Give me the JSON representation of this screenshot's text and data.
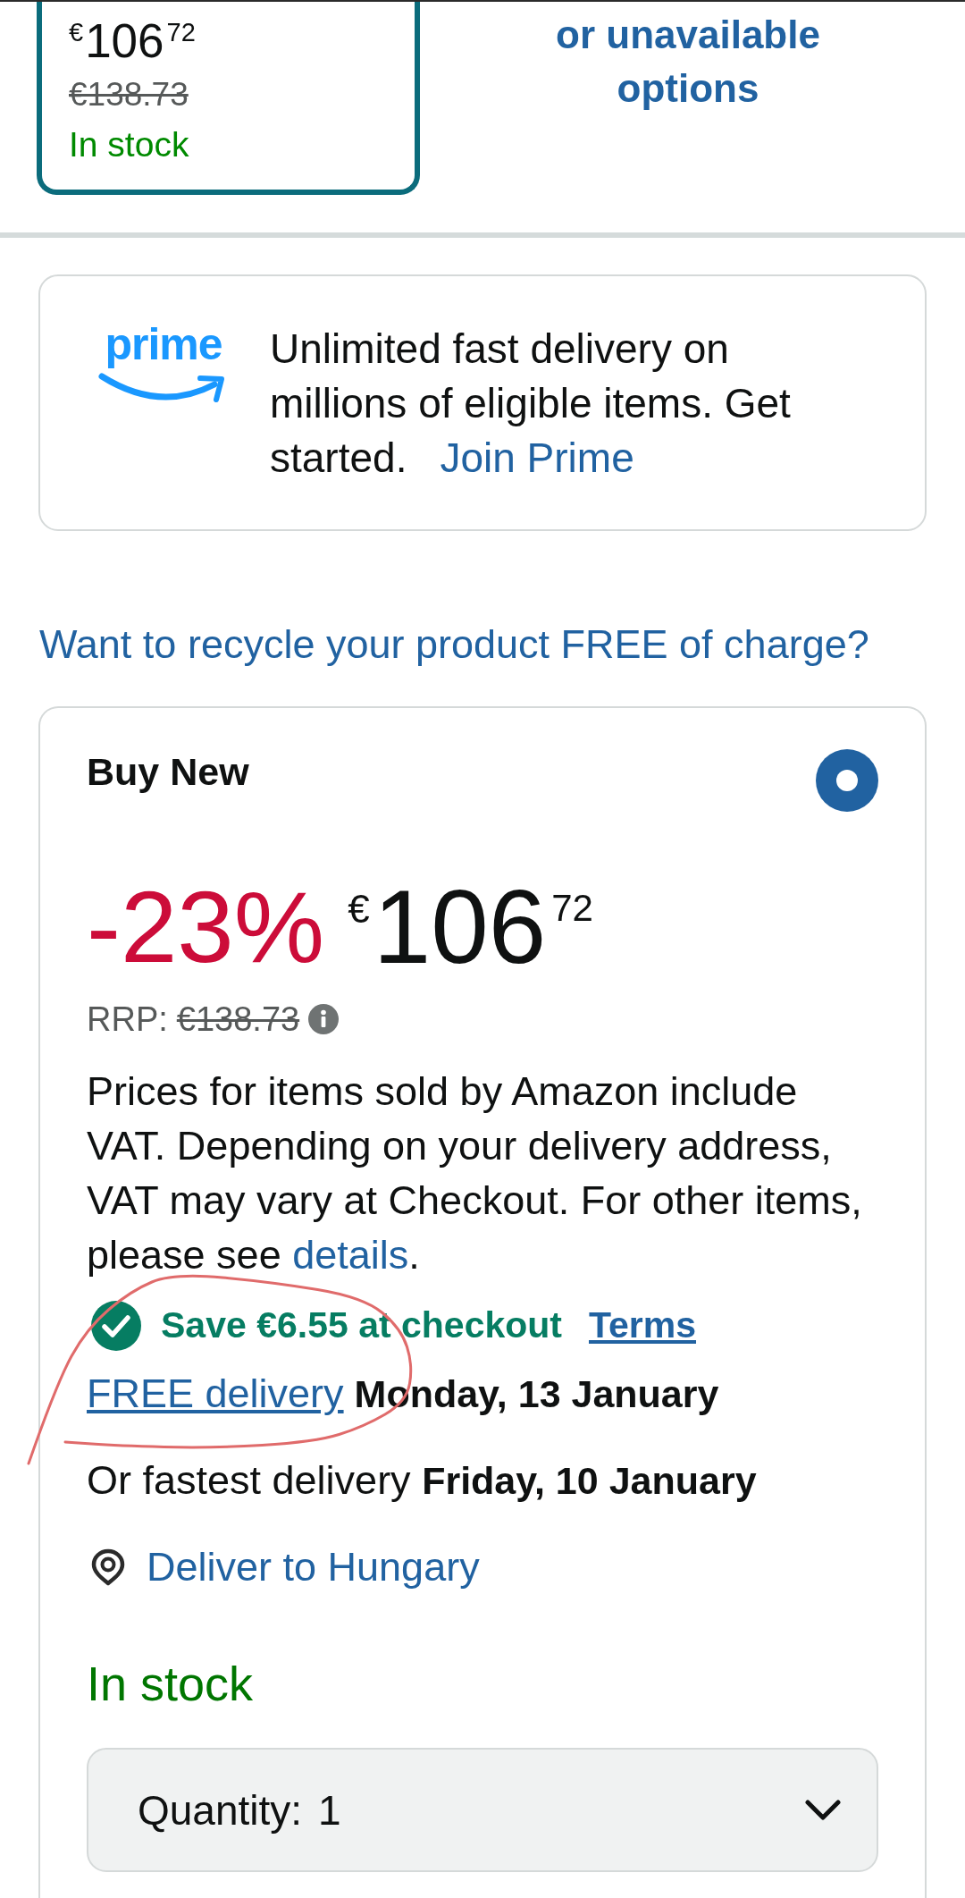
{
  "offer_tile": {
    "selected": true,
    "price": {
      "currency": "€",
      "whole": "106",
      "fraction": "72"
    },
    "list_price": "€138.73",
    "stock": "In stock"
  },
  "other_options_link": "or unavailable options",
  "prime_banner": {
    "logo": "prime",
    "text": "Unlimited fast delivery on millions of eligible items. Get started.",
    "link": "Join Prime"
  },
  "recycle_link": "Want to recycle your product FREE of charge?",
  "buy_box": {
    "title": "Buy New",
    "selected": true,
    "discount": "-23%",
    "price": {
      "currency": "€",
      "whole": "106",
      "fraction": "72"
    },
    "rrp_label": "RRP:",
    "rrp_price": "€138.73",
    "vat_note": {
      "text": "Prices for items sold by Amazon include VAT. Depending on your delivery address, VAT may vary at Checkout. For other items, please see ",
      "link": "details",
      "end": "."
    },
    "coupon": {
      "text": "Save €6.55 at checkout",
      "link": "Terms"
    },
    "delivery": [
      {
        "kind": "link",
        "link": "FREE delivery",
        "text": "**Monday, 13 January**"
      },
      {
        "kind": "plain",
        "text": "Or fastest delivery **Friday, 10 January**"
      }
    ],
    "deliver_to": "Deliver to Hungary",
    "stock": "In stock",
    "quantity": {
      "label": "Quantity:",
      "value": "1"
    }
  },
  "annotations": [
    {
      "kind": "freehand-loop"
    }
  ]
}
